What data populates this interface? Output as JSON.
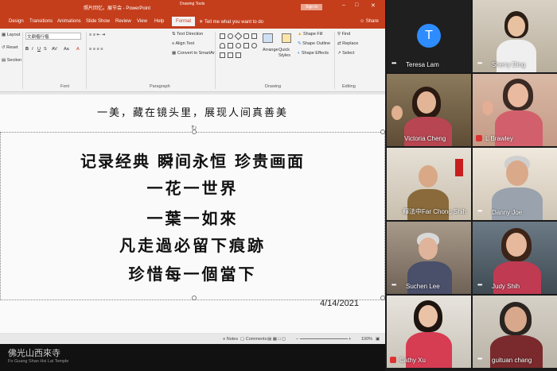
{
  "powerpoint": {
    "window_title": "照片回忆。展节会 - PowerPoint",
    "drawing_tools_label": "Drawing Tools",
    "signin_label": "Sign in",
    "share_label": "Share",
    "tabs": [
      "Design",
      "Transitions",
      "Animations",
      "Slide Show",
      "Review",
      "View",
      "Help",
      "Format"
    ],
    "tell_me": "Tell me what you want to do",
    "ribbon": {
      "layout": "Layout",
      "reset": "Reset",
      "section": "Section",
      "font_name": "文鼎楷行楷",
      "text_direction": "Text Direction",
      "align_text": "Align Text",
      "convert_smartart": "Convert to SmartArt",
      "arrange": "Arrange",
      "quick_styles": "Quick Styles",
      "shape_fill": "Shape Fill",
      "shape_outline": "Shape Outline",
      "shape_effects": "Shape Effects",
      "find": "Find",
      "replace": "Replace",
      "select": "Select",
      "groups": [
        "Font",
        "Paragraph",
        "Drawing",
        "Editing"
      ]
    },
    "slide": {
      "subtitle": "一美，藏在镜头里，展现人间真善美",
      "lines": [
        "记录经典 瞬间永恒 珍贵画面",
        "一花一世界",
        "一葉一如來",
        "凡走過必留下痕跡",
        "珍惜每一個當下"
      ],
      "date": "4/14/2021"
    },
    "status": {
      "notes": "Notes",
      "comments": "Comments",
      "zoom": "100%"
    }
  },
  "watermark": {
    "chinese": "佛光山西來寺",
    "english": "Fo Guang Shan Hsi Lai Temple"
  },
  "participants": [
    {
      "name": "Teresa Lam",
      "muted": false,
      "avatar_letter": "T"
    },
    {
      "name": "Sherry Ding",
      "muted": false
    },
    {
      "name": "Victoria Cheng",
      "muted": false
    },
    {
      "name": "L Brawley",
      "muted": true
    },
    {
      "name": "釋法中Far Chong Shih",
      "muted": false
    },
    {
      "name": "Danny Joe",
      "muted": false
    },
    {
      "name": "Suchen Lee",
      "muted": false
    },
    {
      "name": "Judy Shih",
      "muted": false
    },
    {
      "name": "Cathy Xu",
      "muted": true
    },
    {
      "name": "guituan chang",
      "muted": false
    }
  ],
  "colors": {
    "ppt_accent": "#c43e1c",
    "zoom_avatar_blue": "#2d8cff",
    "muted_red": "#dd3333"
  }
}
